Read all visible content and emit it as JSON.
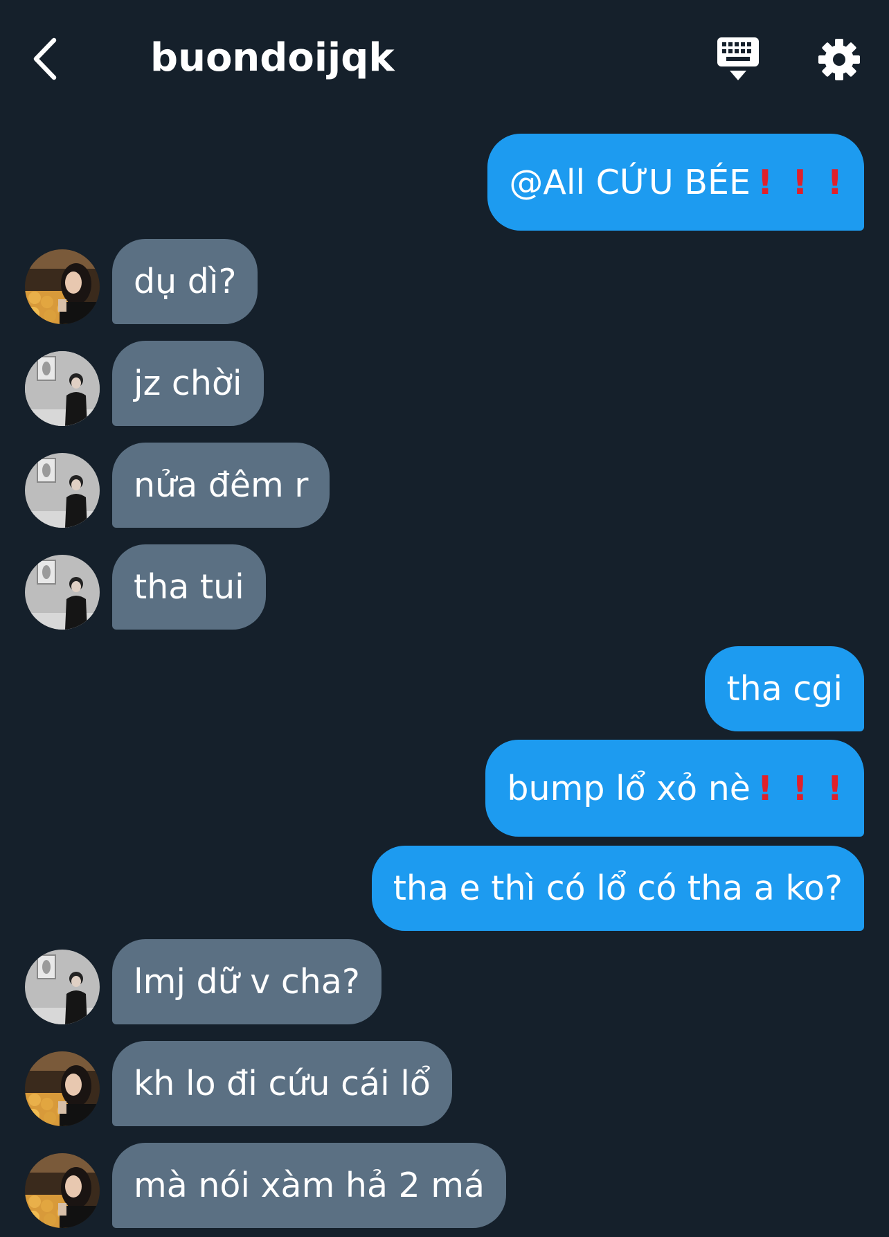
{
  "header": {
    "title": "buondoijqk",
    "back_icon": "chevron-left-icon",
    "keyboard_icon": "keyboard-icon",
    "settings_icon": "gear-icon"
  },
  "colors": {
    "background": "#15202b",
    "outgoing_bubble": "#1d9bf0",
    "incoming_bubble": "#5b7083",
    "text": "#ffffff",
    "exclamation": "#e0202a"
  },
  "messages": [
    {
      "side": "out",
      "text": "@All CỨU BÉE",
      "emoji": "❗❗❗"
    },
    {
      "side": "in",
      "avatar": "avatar-girl",
      "text": "dụ dì?"
    },
    {
      "side": "in",
      "avatar": "avatar-boy",
      "text": "jz chời"
    },
    {
      "side": "in",
      "avatar": "avatar-boy",
      "text": "nửa đêm r"
    },
    {
      "side": "in",
      "avatar": "avatar-boy",
      "text": "tha tui"
    },
    {
      "side": "out",
      "text": "tha cgi"
    },
    {
      "side": "out",
      "text": "bump lổ xỏ nè",
      "emoji": "❗❗❗"
    },
    {
      "side": "out",
      "text": "tha e thì có lổ có tha a ko?"
    },
    {
      "side": "in",
      "avatar": "avatar-boy",
      "text": "lmj dữ v cha?"
    },
    {
      "side": "in",
      "avatar": "avatar-girl",
      "text": "kh lo đi cứu cái lổ"
    },
    {
      "side": "in",
      "avatar": "avatar-girl",
      "text": "mà nói xàm hả 2 má"
    }
  ]
}
